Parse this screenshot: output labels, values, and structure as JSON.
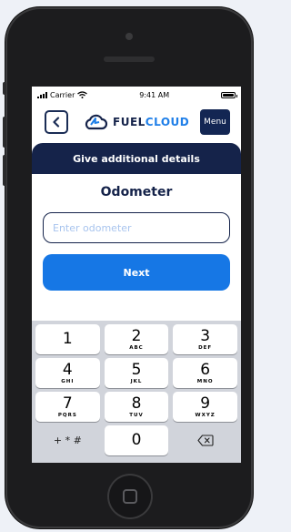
{
  "status_bar": {
    "carrier": "Carrier",
    "time": "9:41 AM"
  },
  "header": {
    "logo_part1": "FUEL",
    "logo_part2": "CLOUD",
    "menu_label": "Menu"
  },
  "banner": {
    "text": "Give additional details"
  },
  "form": {
    "title": "Odometer",
    "input_placeholder": "Enter odometer",
    "input_value": "",
    "next_label": "Next"
  },
  "keypad": {
    "keys": [
      {
        "num": "1",
        "letters": ""
      },
      {
        "num": "2",
        "letters": "ABC"
      },
      {
        "num": "3",
        "letters": "DEF"
      },
      {
        "num": "4",
        "letters": "GHI"
      },
      {
        "num": "5",
        "letters": "JKL"
      },
      {
        "num": "6",
        "letters": "MNO"
      },
      {
        "num": "7",
        "letters": "PQRS"
      },
      {
        "num": "8",
        "letters": "TUV"
      },
      {
        "num": "9",
        "letters": "WXYZ"
      },
      {
        "num": "+ * #",
        "letters": ""
      },
      {
        "num": "0",
        "letters": ""
      }
    ],
    "delete_icon": "backspace-icon"
  },
  "colors": {
    "brand_navy": "#15234a",
    "brand_blue": "#1f7fe8",
    "button_blue": "#1677e5"
  }
}
